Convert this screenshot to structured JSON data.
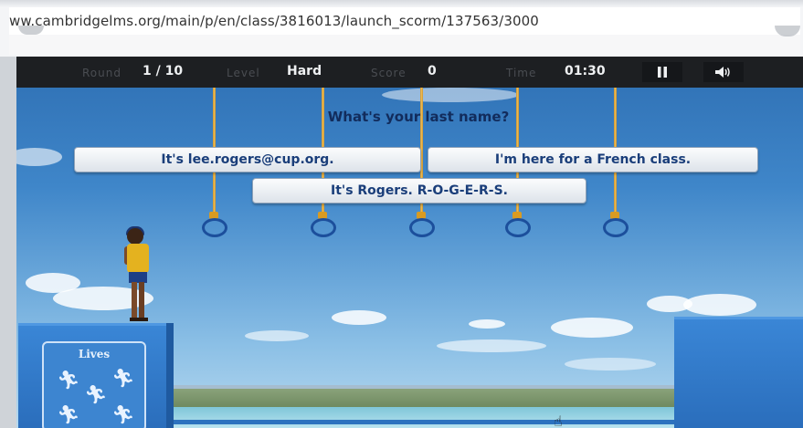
{
  "browser": {
    "url": "ww.cambridgelms.org/main/p/en/class/3816013/launch_scorm/137563/3000"
  },
  "hud": {
    "round_label": "Round",
    "round_value": "1 / 10",
    "level_label": "Level",
    "level_value": "Hard",
    "score_label": "Score",
    "score_value": "0",
    "time_label": "Time",
    "time_value": "01:30",
    "pause_icon": "pause-icon",
    "sound_icon": "speaker-icon"
  },
  "game": {
    "question": "What's your last name?",
    "answers": [
      "It's lee.rogers@cup.org.",
      "I'm here for a French class.",
      "It's Rogers. R-O-G-E-R-S."
    ],
    "lives_title": "Lives",
    "lives_count": 5,
    "rings_count": 5
  },
  "colors": {
    "hud_background": "#1d1f22",
    "sky": "#3f86c9",
    "answer_text": "#1a3e7a",
    "platform": "#2a6dbb",
    "ring": "#1c4f9c"
  }
}
